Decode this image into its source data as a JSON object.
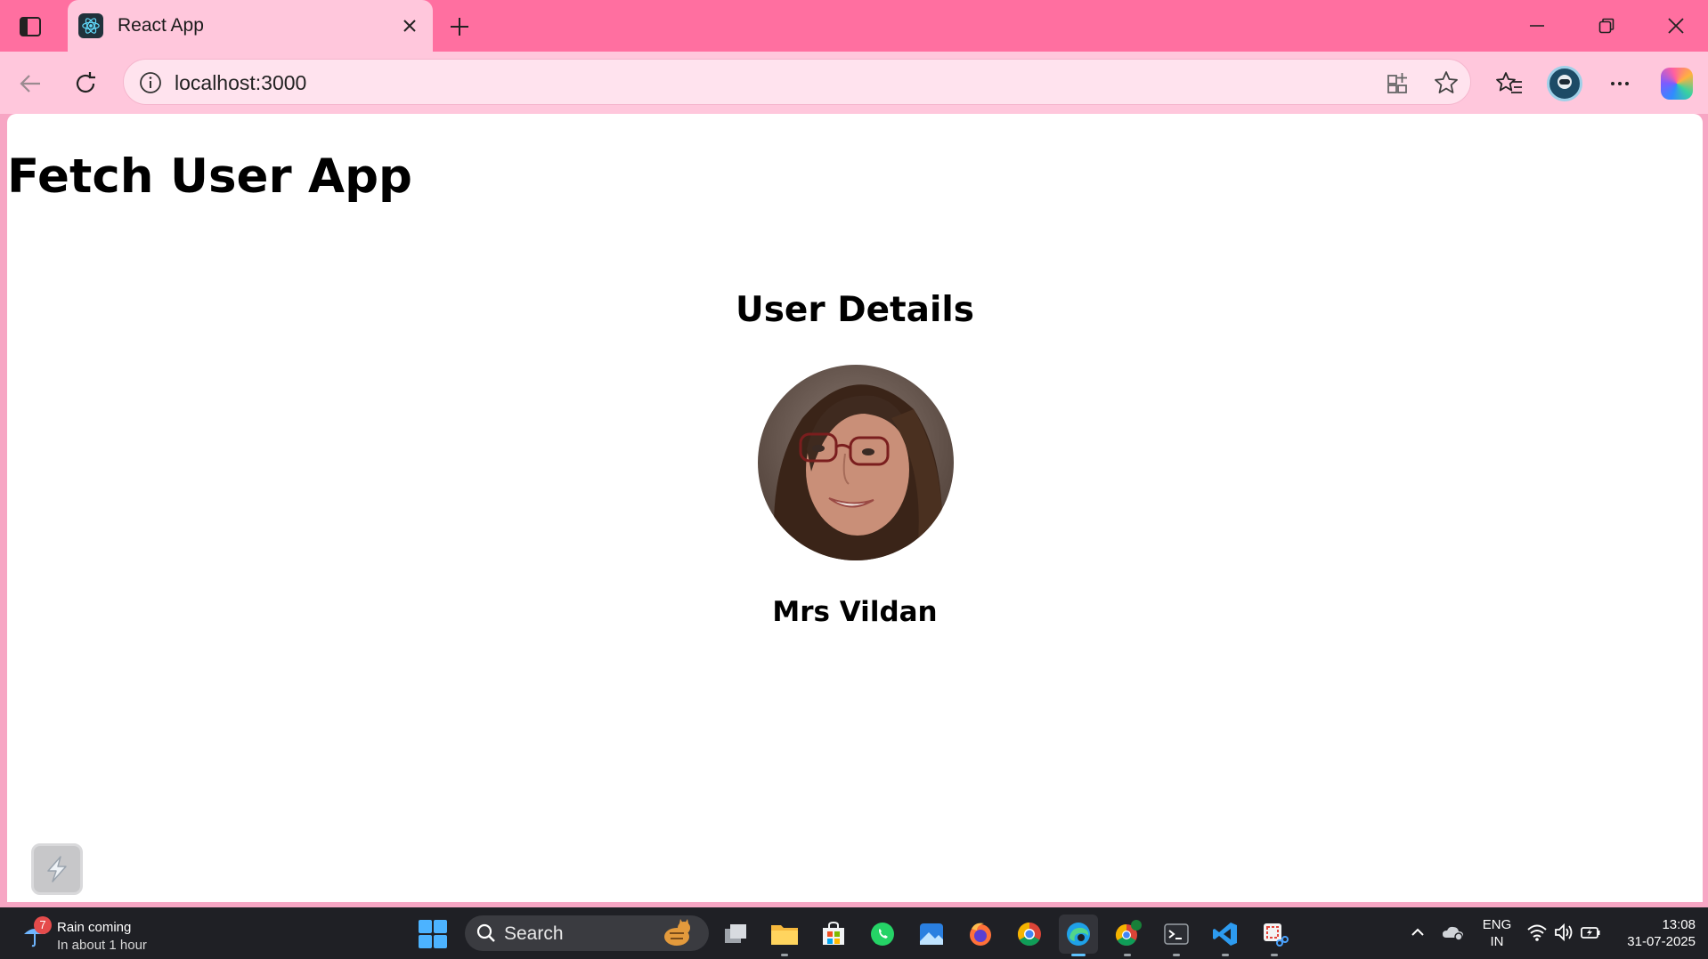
{
  "browser": {
    "tab": {
      "title": "React App"
    },
    "address_bar": {
      "url": "localhost:3000"
    }
  },
  "page": {
    "app_title": "Fetch User App",
    "details_heading": "User Details",
    "user": {
      "name": "Mrs Vildan"
    }
  },
  "taskbar": {
    "weather": {
      "badge": "7",
      "title": "Rain coming",
      "subtitle": "In about 1 hour"
    },
    "search": {
      "label": "Search"
    },
    "language": {
      "line1": "ENG",
      "line2": "IN"
    },
    "clock": {
      "time": "13:08",
      "date": "31-07-2025"
    }
  },
  "colors": {
    "titlebar": "#ff6fa0",
    "toolbar": "#ffc7dc",
    "taskbar": "#1f2025",
    "page_background": "#ffffff"
  },
  "icons": [
    "sidebar-toggle-icon",
    "react-favicon-icon",
    "close-icon",
    "plus-icon",
    "minimize-icon",
    "restore-icon",
    "back-icon",
    "refresh-icon",
    "info-icon",
    "app-available-icon",
    "star-icon",
    "favorites-icon",
    "profile-icon",
    "more-icon",
    "copilot-icon",
    "extension-icon",
    "weather-icon",
    "windows-start-icon",
    "search-icon",
    "task-view-icon",
    "file-explorer-icon",
    "store-icon",
    "whatsapp-icon",
    "photos-icon",
    "firefox-icon",
    "chrome-icon",
    "edge-icon",
    "terminal-icon",
    "vscode-icon",
    "snipping-tool-icon",
    "chevron-up-icon",
    "onedrive-icon",
    "wifi-icon",
    "volume-icon",
    "battery-icon"
  ]
}
